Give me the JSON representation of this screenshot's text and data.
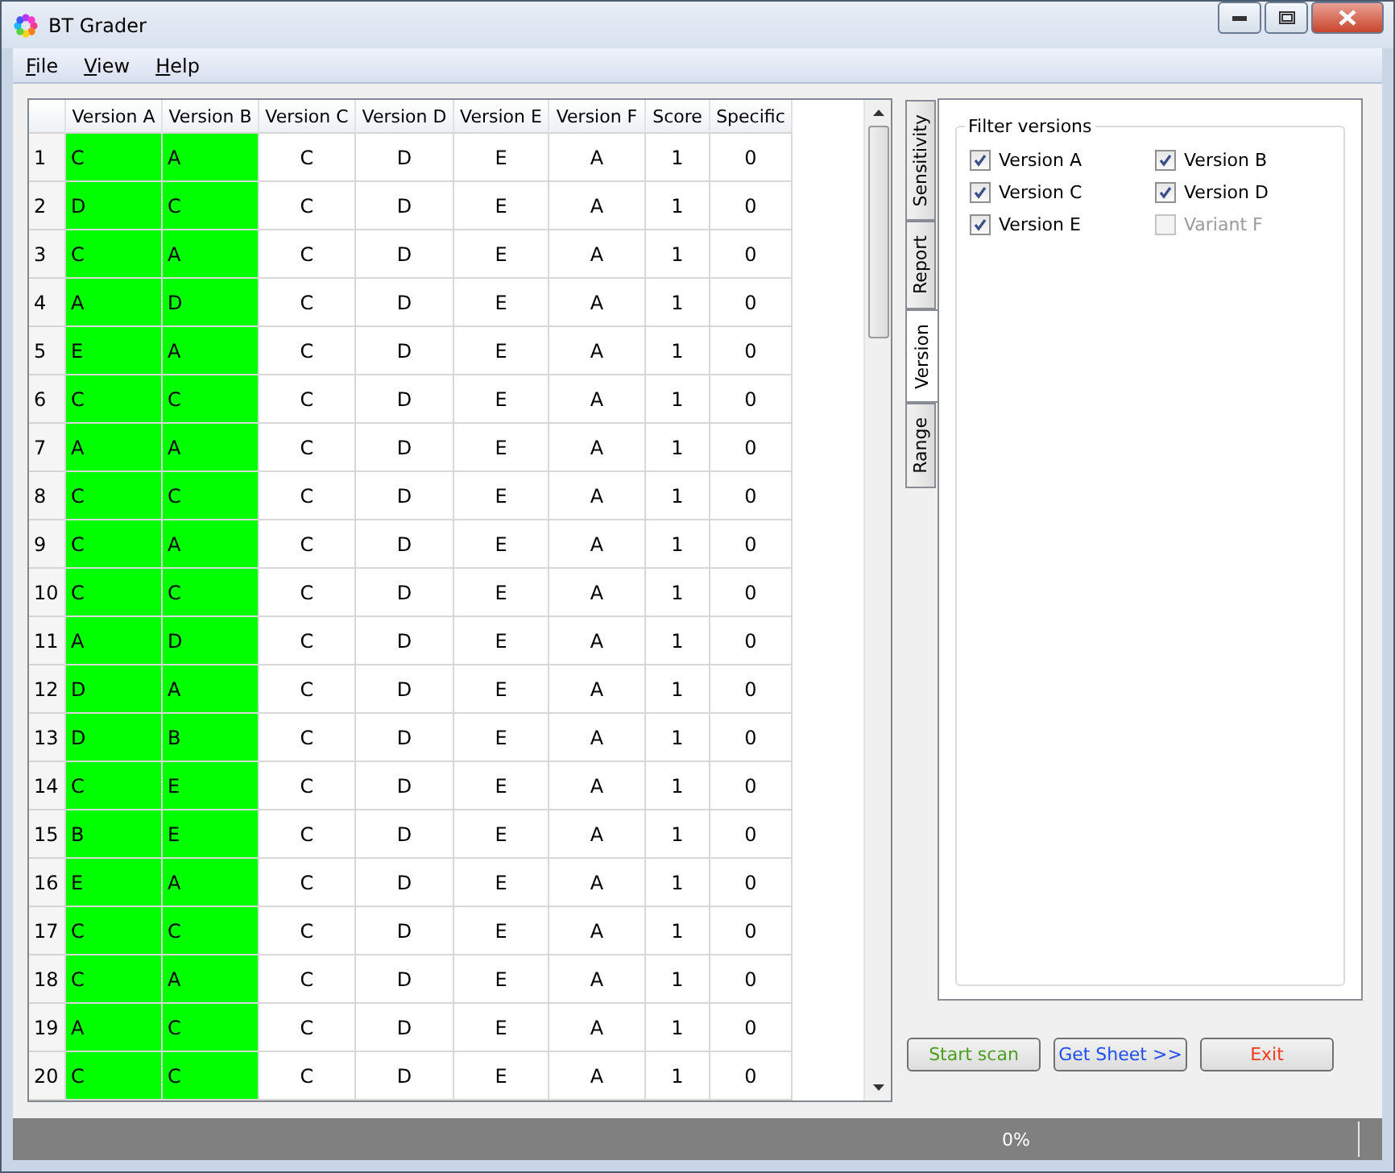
{
  "window": {
    "title": "BT Grader"
  },
  "menu": [
    {
      "label": "File"
    },
    {
      "label": "View"
    },
    {
      "label": "Help"
    }
  ],
  "table": {
    "columns": [
      {
        "label": "Version A",
        "highlighted": true
      },
      {
        "label": "Version B",
        "highlighted": true
      },
      {
        "label": "Version C",
        "highlighted": false
      },
      {
        "label": "Version D",
        "highlighted": false
      },
      {
        "label": "Version E",
        "highlighted": false
      },
      {
        "label": "Version F",
        "highlighted": false
      },
      {
        "label": "Score",
        "highlighted": false
      },
      {
        "label": "Specific",
        "highlighted": false
      }
    ],
    "rows": [
      {
        "number": "1",
        "cells": [
          "C",
          "A",
          "C",
          "D",
          "E",
          "A",
          "1",
          "0"
        ]
      },
      {
        "number": "2",
        "cells": [
          "D",
          "C",
          "C",
          "D",
          "E",
          "A",
          "1",
          "0"
        ]
      },
      {
        "number": "3",
        "cells": [
          "C",
          "A",
          "C",
          "D",
          "E",
          "A",
          "1",
          "0"
        ]
      },
      {
        "number": "4",
        "cells": [
          "A",
          "D",
          "C",
          "D",
          "E",
          "A",
          "1",
          "0"
        ]
      },
      {
        "number": "5",
        "cells": [
          "E",
          "A",
          "C",
          "D",
          "E",
          "A",
          "1",
          "0"
        ]
      },
      {
        "number": "6",
        "cells": [
          "C",
          "C",
          "C",
          "D",
          "E",
          "A",
          "1",
          "0"
        ]
      },
      {
        "number": "7",
        "cells": [
          "A",
          "A",
          "C",
          "D",
          "E",
          "A",
          "1",
          "0"
        ]
      },
      {
        "number": "8",
        "cells": [
          "C",
          "C",
          "C",
          "D",
          "E",
          "A",
          "1",
          "0"
        ]
      },
      {
        "number": "9",
        "cells": [
          "C",
          "A",
          "C",
          "D",
          "E",
          "A",
          "1",
          "0"
        ]
      },
      {
        "number": "10",
        "cells": [
          "C",
          "C",
          "C",
          "D",
          "E",
          "A",
          "1",
          "0"
        ]
      },
      {
        "number": "11",
        "cells": [
          "A",
          "D",
          "C",
          "D",
          "E",
          "A",
          "1",
          "0"
        ]
      },
      {
        "number": "12",
        "cells": [
          "D",
          "A",
          "C",
          "D",
          "E",
          "A",
          "1",
          "0"
        ]
      },
      {
        "number": "13",
        "cells": [
          "D",
          "B",
          "C",
          "D",
          "E",
          "A",
          "1",
          "0"
        ]
      },
      {
        "number": "14",
        "cells": [
          "C",
          "E",
          "C",
          "D",
          "E",
          "A",
          "1",
          "0"
        ]
      },
      {
        "number": "15",
        "cells": [
          "B",
          "E",
          "C",
          "D",
          "E",
          "A",
          "1",
          "0"
        ]
      },
      {
        "number": "16",
        "cells": [
          "E",
          "A",
          "C",
          "D",
          "E",
          "A",
          "1",
          "0"
        ]
      },
      {
        "number": "17",
        "cells": [
          "C",
          "C",
          "C",
          "D",
          "E",
          "A",
          "1",
          "0"
        ]
      },
      {
        "number": "18",
        "cells": [
          "C",
          "A",
          "C",
          "D",
          "E",
          "A",
          "1",
          "0"
        ]
      },
      {
        "number": "19",
        "cells": [
          "A",
          "C",
          "C",
          "D",
          "E",
          "A",
          "1",
          "0"
        ]
      },
      {
        "number": "20",
        "cells": [
          "C",
          "C",
          "C",
          "D",
          "E",
          "A",
          "1",
          "0"
        ]
      }
    ]
  },
  "side_tabs": [
    {
      "label": "Sensitivity",
      "selected": false
    },
    {
      "label": "Report",
      "selected": false
    },
    {
      "label": "Version",
      "selected": true
    },
    {
      "label": "Range",
      "selected": false
    }
  ],
  "filter": {
    "title": "Filter versions",
    "items": [
      {
        "label": "Version A",
        "checked": true,
        "disabled": false
      },
      {
        "label": "Version B",
        "checked": true,
        "disabled": false
      },
      {
        "label": "Version C",
        "checked": true,
        "disabled": false
      },
      {
        "label": "Version D",
        "checked": true,
        "disabled": false
      },
      {
        "label": "Version E",
        "checked": true,
        "disabled": false
      },
      {
        "label": "Variant F",
        "checked": false,
        "disabled": true
      }
    ]
  },
  "buttons": [
    {
      "label": "Start scan",
      "color": "#4aa01e"
    },
    {
      "label": "Get Sheet >>",
      "color": "#1f4ff0"
    },
    {
      "label": "Exit",
      "color": "#f03c1e"
    }
  ],
  "status_bar": {
    "progress": "0%"
  }
}
